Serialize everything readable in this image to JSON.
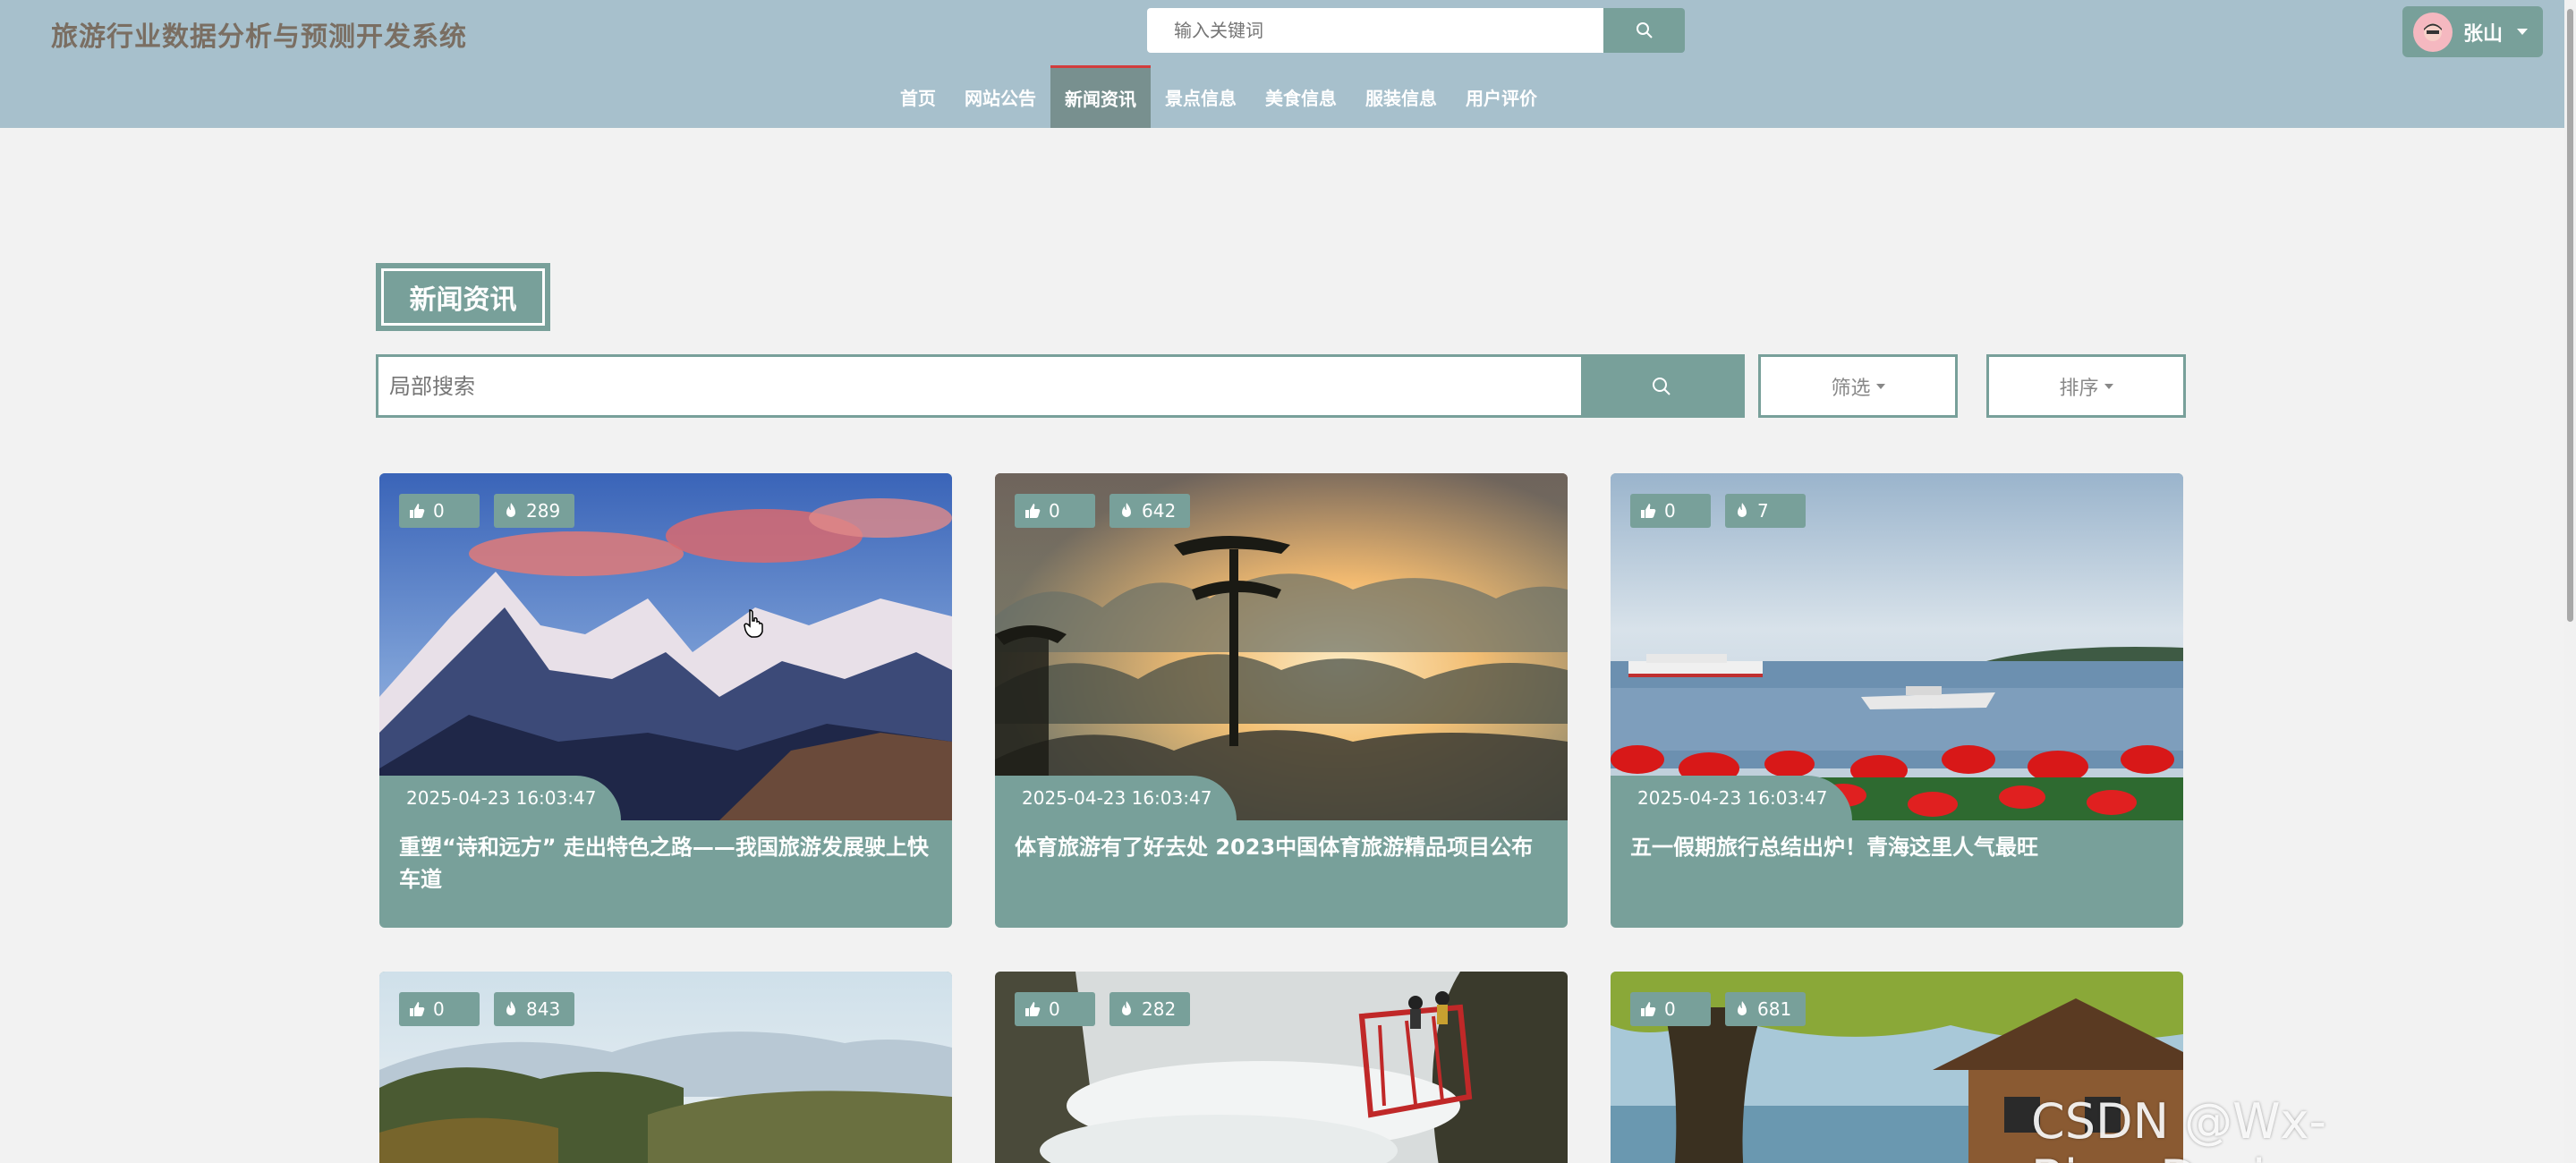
{
  "header": {
    "site_title": "旅游行业数据分析与预测开发系统",
    "search_placeholder": "输入关键词",
    "user_name": "张山"
  },
  "nav": {
    "items": [
      {
        "label": "首页"
      },
      {
        "label": "网站公告"
      },
      {
        "label": "新闻资讯",
        "active": true
      },
      {
        "label": "景点信息"
      },
      {
        "label": "美食信息"
      },
      {
        "label": "服装信息"
      },
      {
        "label": "用户评价"
      }
    ]
  },
  "section": {
    "title": "新闻资讯",
    "search_placeholder": "局部搜索",
    "filter_label": "筛选",
    "sort_label": "排序"
  },
  "cards": [
    {
      "likes": "0",
      "views": "289",
      "date": "2025-04-23 16:03:47",
      "title": "重塑“诗和远方” 走出特色之路——我国旅游发展驶上快车道",
      "image": "snow-mountain-sunset"
    },
    {
      "likes": "0",
      "views": "642",
      "date": "2025-04-23 16:03:47",
      "title": "体育旅游有了好去处 2023中国体育旅游精品项目公布",
      "image": "misty-mountain-pines"
    },
    {
      "likes": "0",
      "views": "7",
      "date": "2025-04-23 16:03:47",
      "title": "五一假期旅行总结出炉！青海这里人气最旺",
      "image": "lake-ferry-red-flowers"
    },
    {
      "likes": "0",
      "views": "843",
      "image": "hazy-forest-hills"
    },
    {
      "likes": "0",
      "views": "282",
      "image": "cliff-walkway-clouds"
    },
    {
      "likes": "0",
      "views": "681",
      "image": "tree-cabin-lake"
    }
  ],
  "watermark": "CSDN @Wx-Biye_Design",
  "colors": {
    "header_bg": "#a7c0cc",
    "accent": "#78a09a",
    "page_bg": "#f2f2f2",
    "active_underline": "#d23c3c"
  }
}
